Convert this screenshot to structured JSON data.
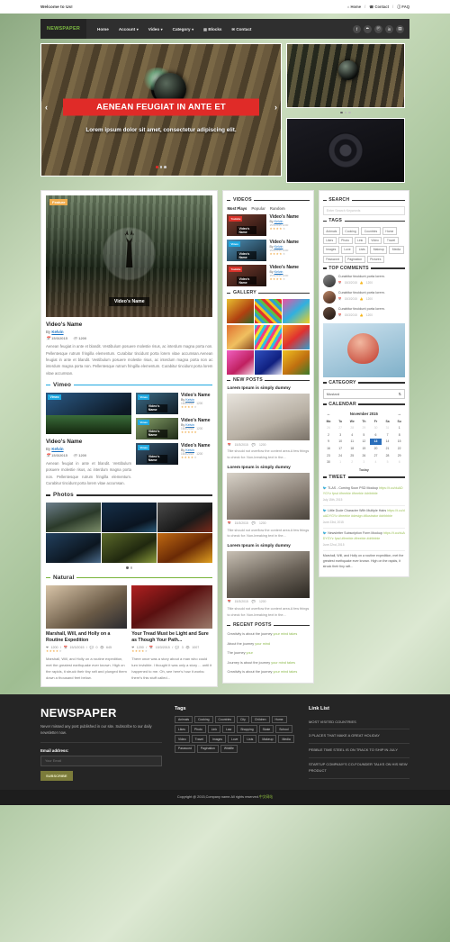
{
  "topbar": {
    "welcome": "Welcome to Us!",
    "links": [
      {
        "label": "Home",
        "icon": "home-icon"
      },
      {
        "label": "Contact",
        "icon": "phone-icon"
      },
      {
        "label": "FAQ",
        "icon": "help-icon"
      }
    ]
  },
  "nav": {
    "brand": "NEWSPAPER",
    "items": [
      {
        "label": "Home",
        "caret": false,
        "icon": ""
      },
      {
        "label": "Account",
        "caret": true,
        "icon": ""
      },
      {
        "label": "Video",
        "caret": true,
        "icon": ""
      },
      {
        "label": "Category",
        "caret": true,
        "icon": ""
      },
      {
        "label": "Blocks",
        "caret": false,
        "icon": "blocks-icon"
      },
      {
        "label": "Contact",
        "caret": false,
        "icon": "envelope-icon"
      }
    ],
    "social": [
      {
        "name": "facebook-icon",
        "glyph": "f"
      },
      {
        "name": "twitter-icon",
        "glyph": "✒"
      },
      {
        "name": "pinterest-icon",
        "glyph": "Ⓟ"
      },
      {
        "name": "linkedin-icon",
        "glyph": "in"
      },
      {
        "name": "rss-icon",
        "glyph": "▤"
      }
    ]
  },
  "hero": {
    "title": "AENEAN FEUGIAT IN ANTE ET",
    "subtitle": "Lorem ipsum dolor sit amet, consectetur adipiscing elit.",
    "prev": "‹",
    "next": "›"
  },
  "feature": {
    "badge": "Feature",
    "overlay_label": "Video's Name",
    "title": "Video's Name",
    "by_prefix": "By",
    "author": "Kelvin",
    "date": "15/3/2015",
    "views": "1200",
    "excerpt": "Aenean feugiat in ante et blandit. Vestibulum posuere molestie risus, ac interdum magna porta non. Pellentesque rutrum fringilla elementum. Curabitur tincidunt porta lorem vitae accumsan.Aenean feugiat in ante et blandit. Vestibulum posuere molestie risus, ac interdum magna porta non ac interdum magna porta non. Pellentesque rutrum fringilla elementum. Curabitur tincidunt porta lorem vitae accumsan."
  },
  "sections": {
    "vimeo": "Vimeo",
    "photos": "Photos",
    "natural": "Natural"
  },
  "vimeo": {
    "main": {
      "tag": "Vimeo",
      "overlay_label": "Video's Name",
      "title": "Video's Name",
      "by_prefix": "By",
      "author": "Kelvin",
      "date": "15/3/2015",
      "views": "1200",
      "excerpt": "Aenean feugiat in ante et blandit. Vestibulum posuere molestie risus, ac interdum magna porta non. Pellentesque rutrum fringilla elementum. Curabitur tincidunt porta lorem vitae accumsan."
    },
    "list": [
      {
        "tag": "Vimeo",
        "overlay_label": "Video's Name",
        "title": "Video's Name",
        "author": "Kelvin",
        "date": "15/3/2015",
        "views": "1200",
        "stars": 4
      },
      {
        "tag": "Vimeo",
        "overlay_label": "Video's Name",
        "title": "Video's Name",
        "author": "Kelvin",
        "date": "15/3/2015",
        "views": "1200",
        "stars": 5
      },
      {
        "tag": "Vimeo",
        "overlay_label": "Video's Name",
        "title": "Video's Name",
        "author": "Kelvin",
        "date": "15/3/2015",
        "views": "1200",
        "stars": 4
      }
    ]
  },
  "natural": [
    {
      "title": "Marshall, Will, and Holly on a Routine Expedition",
      "likes": "1200",
      "date": "15/3/2015",
      "comments": "0",
      "views": "645",
      "stars": 4,
      "text": "Marshall, Will, and Holly on a routine expedition, met the greatest earthquake ever known. High on the rapids, it struck their tiny raft and plunged them down a thousand feet below."
    },
    {
      "title": "Your Tread Must be Light and Sure as Though Your Path...",
      "likes": "1200",
      "date": "15/3/2015",
      "comments": "3",
      "views": "1007",
      "stars": 4,
      "text": "There once was a story about a man who could turn invisible. I thought it was only a story ... until it happened to me. Oh, see here's how it works: there's this stuff called..."
    }
  ],
  "widgets": {
    "videos": {
      "title": "VIDEOS",
      "tabs": [
        "Most Plays",
        "Popular",
        "Random"
      ],
      "active_tab": "Most Plays",
      "items": [
        {
          "tag": "Youtube",
          "overlay_label": "Video's Name",
          "title": "Video's Name",
          "by_prefix": "By",
          "author": "Kelvin",
          "date": "15/3/2015",
          "views": "1200",
          "stars": 4
        },
        {
          "tag": "Vimeo",
          "overlay_label": "Video's Name",
          "title": "Video's Name",
          "by_prefix": "By",
          "author": "Kelvin",
          "date": "15/3/2015",
          "views": "1200",
          "stars": 4
        },
        {
          "tag": "Youtube",
          "overlay_label": "Video's Name",
          "title": "Video's Name",
          "by_prefix": "By",
          "author": "Kelvin",
          "date": "15/3/2015",
          "views": "1200",
          "stars": 4
        }
      ]
    },
    "gallery": {
      "title": "GALLERY"
    },
    "new_posts": {
      "title": "NEW POSTS",
      "items": [
        {
          "title": "Lorem Ipsum is simply dummy",
          "date": "15/3/2015",
          "comments": "1200",
          "text": "Title should not overflow the content area.A few things to check for: Non-breaking text in the..."
        },
        {
          "title": "Lorem Ipsum is simply dummy",
          "date": "15/3/2015",
          "comments": "1200",
          "text": "Title should not overflow the content area.A few things to check for: Non-breaking text in the..."
        },
        {
          "title": "Lorem Ipsum is simply dummy",
          "date": "15/3/2015",
          "comments": "1200",
          "text": "Title should not overflow the content area.A few things to check for: Non-breaking text in the..."
        }
      ]
    },
    "recent_posts": {
      "title": "RECENT POSTS",
      "items": [
        {
          "text": "Creativity is about the journey ",
          "link": "your mind takes"
        },
        {
          "text": "About the journey ",
          "link": "your mind"
        },
        {
          "text": "The journey ",
          "link": "your"
        },
        {
          "text": "Journey is about the journey ",
          "link": "your mind takes"
        },
        {
          "text": "Creativity is about the journey ",
          "link": "your mind takes"
        }
      ]
    },
    "search": {
      "title": "SEARCH",
      "placeholder": "Enter Search Keywords"
    },
    "tags": {
      "title": "TAGS",
      "items": [
        "Animals",
        "Cooking",
        "Countries",
        "Home",
        "Likes",
        "Photo",
        "Link",
        "Video",
        "Travel",
        "Images",
        "Love",
        "Lists",
        "Makeup",
        "Media",
        "Password",
        "Pagination",
        "Pictures"
      ]
    },
    "top_comments": {
      "title": "TOP COMMENTS",
      "items": [
        {
          "text": "Curabitur tincidunt porta lorem.",
          "date": "15/3/2015",
          "likes": "1200"
        },
        {
          "text": "Curabitur tincidunt porta lorem.",
          "date": "15/3/2015",
          "likes": "1200"
        },
        {
          "text": "Curabitur tincidunt porta lorem.",
          "date": "15/3/2015",
          "likes": "1200"
        }
      ]
    },
    "category": {
      "title": "CATEGORY",
      "selected": "Mustard"
    },
    "calendar": {
      "title": "CALENDAR",
      "month": "November 2015",
      "prev": "←",
      "next": "→",
      "weekdays": [
        "Mo",
        "Tu",
        "We",
        "Th",
        "Fr",
        "Sa",
        "Su"
      ],
      "weeks": [
        [
          {
            "d": "26",
            "mut": true
          },
          {
            "d": "27",
            "mut": true
          },
          {
            "d": "28",
            "mut": true
          },
          {
            "d": "29",
            "mut": true
          },
          {
            "d": "30",
            "mut": true
          },
          {
            "d": "31",
            "mut": true
          },
          {
            "d": "1",
            "mut": false
          }
        ],
        [
          {
            "d": "2",
            "mut": false
          },
          {
            "d": "3",
            "mut": false
          },
          {
            "d": "4",
            "mut": false
          },
          {
            "d": "5",
            "mut": false
          },
          {
            "d": "6",
            "mut": false
          },
          {
            "d": "7",
            "mut": false
          },
          {
            "d": "8",
            "mut": false
          }
        ],
        [
          {
            "d": "9",
            "mut": false
          },
          {
            "d": "10",
            "mut": false
          },
          {
            "d": "11",
            "mut": false
          },
          {
            "d": "12",
            "mut": false
          },
          {
            "d": "13",
            "mut": false,
            "sel": true
          },
          {
            "d": "14",
            "mut": false
          },
          {
            "d": "15",
            "mut": false
          }
        ],
        [
          {
            "d": "16",
            "mut": false
          },
          {
            "d": "17",
            "mut": false
          },
          {
            "d": "18",
            "mut": false
          },
          {
            "d": "19",
            "mut": false
          },
          {
            "d": "20",
            "mut": false
          },
          {
            "d": "21",
            "mut": false
          },
          {
            "d": "22",
            "mut": false
          }
        ],
        [
          {
            "d": "23",
            "mut": false
          },
          {
            "d": "24",
            "mut": false
          },
          {
            "d": "25",
            "mut": false
          },
          {
            "d": "26",
            "mut": false
          },
          {
            "d": "27",
            "mut": false
          },
          {
            "d": "28",
            "mut": false
          },
          {
            "d": "29",
            "mut": false
          }
        ],
        [
          {
            "d": "30",
            "mut": false
          },
          {
            "d": "1",
            "mut": true
          },
          {
            "d": "2",
            "mut": true
          },
          {
            "d": "3",
            "mut": true
          },
          {
            "d": "4",
            "mut": true
          },
          {
            "d": "5",
            "mut": true
          },
          {
            "d": "6",
            "mut": true
          }
        ]
      ],
      "today": "Today"
    },
    "tweet": {
      "title": "TWEET",
      "items": [
        {
          "text": "TLAS - Coming Soon PSD Mockup",
          "link": "https://t.co/duADYGYz fpsd #freebie #freebie #dribbble",
          "date": "July 15th, 2015"
        },
        {
          "text": "Little Dude Character With Multiple Hairs",
          "link": "https://t.co/duADYGYz #freebie #design #illustrator #dribbble",
          "date": "June 23rd, 2015"
        },
        {
          "text": "Newsletter Subscription Form Mockup",
          "link": "https://t.co/duADYGYz fpsd #freebie #freebie #dribbble",
          "date": "June 22nd, 2015"
        },
        {
          "text": "Marshall, Will, and Holly on a routine expedition, met the greatest earthquake ever known. High on the rapids, it struck their tiny raft...",
          "link": "",
          "date": ""
        }
      ]
    }
  },
  "footer": {
    "brand": "NEWSPAPER",
    "tagline": "Never missed any post published in our site. Subscribe to our daily newsletter now.",
    "email_label": "Email address:",
    "email_placeholder": "Your Email",
    "subscribe": "SUBSCRIBE",
    "tags_title": "Tags",
    "tags": [
      "Animals",
      "Cooking",
      "Countries",
      "City",
      "Children",
      "Home",
      "Likes",
      "Photo",
      "Link",
      "Law",
      "Shopping",
      "Skate",
      "School",
      "Video",
      "Travel",
      "Images",
      "Love",
      "Lists",
      "Makeup",
      "Media",
      "Password",
      "Pagination",
      "Wildlife"
    ],
    "links_title": "Link List",
    "links": [
      "MOST VISITED COUNTRIES",
      "3 PLACES THAT MAKE A GREAT HOLIDAY",
      "PEBBLE TIME STEEL IS ON TRACK TO SHIP IN JULY",
      "STARTUP COMPANY'S CO-FOUNDER TALKS ON HIS NEW PRODUCT"
    ],
    "copyright": "Copyright @ 2015,Company name.All rights reserved.",
    "credit": "中文网站"
  }
}
